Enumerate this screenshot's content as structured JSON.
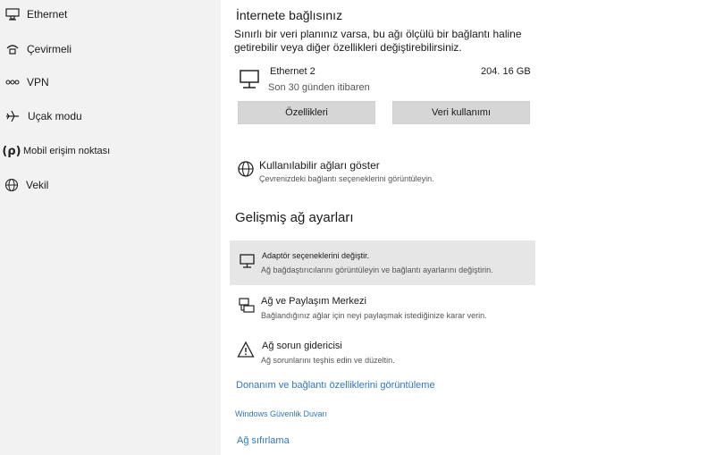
{
  "sidebar": {
    "items": [
      {
        "label": "Ethernet",
        "icon": "ethernet-icon"
      },
      {
        "label": "Çevirmeli",
        "icon": "dialup-icon"
      },
      {
        "label": "VPN",
        "icon": "vpn-icon"
      },
      {
        "label": "Uçak modu",
        "icon": "airplane-icon"
      },
      {
        "label": "Mobil erişim noktası",
        "icon": "hotspot-icon",
        "icon_text": "(ρ)"
      },
      {
        "label": "Vekil",
        "icon": "globe-icon"
      }
    ]
  },
  "status": {
    "title": "İnternete bağlısınız",
    "description": "Sınırlı bir veri planınız varsa, bu ağı ölçülü bir bağlantı haline getirebilir veya diğer özellikleri değiştirebilirsiniz."
  },
  "connection": {
    "name": "Ethernet 2",
    "period": "Son 30 günden itibaren",
    "usage": "204. 16 GB"
  },
  "buttons": {
    "properties": "Özellikleri",
    "data_usage": "Veri kullanımı"
  },
  "available": {
    "title": "Kullanılabilir ağları göster",
    "subtitle": "Çevrenizdeki bağlantı seçeneklerini görüntüleyin."
  },
  "advanced": {
    "title": "Gelişmiş ağ ayarları",
    "items": [
      {
        "title": "Adaptör seçeneklerini değiştir.",
        "subtitle": "Ağ bağdaştırıcılarını görüntüleyin ve bağlantı ayarlarını değiştirin."
      },
      {
        "title": "Ağ ve Paylaşım Merkezi",
        "subtitle": "Bağlandığınız ağlar için neyi paylaşmak istediğinize karar verin."
      },
      {
        "title": "Ağ sorun gidericisi",
        "subtitle": "Ağ sorunlarını teşhis edin ve düzeltin."
      }
    ]
  },
  "links": {
    "hardware": "Donanım ve bağlantı özelliklerini görüntüleme",
    "firewall": "Windows Güvenlik Duvarı",
    "reset": "Ağ sıfırlama"
  },
  "colors": {
    "sidebar_bg": "#f2f2f2",
    "link": "#2b78c2",
    "button_bg": "#d6d6d6",
    "highlight_bg": "#e6e6e6"
  }
}
